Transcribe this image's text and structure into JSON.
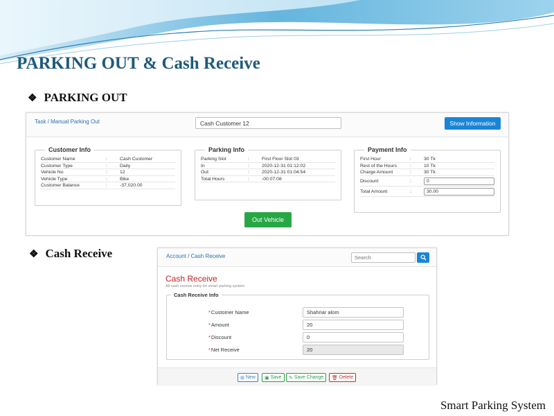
{
  "slide": {
    "title": "PARKING OUT & Cash Receive",
    "section1": "PARKING OUT",
    "section2": "Cash Receive",
    "footer": "Smart Parking System",
    "bullet": "❖"
  },
  "parking_out": {
    "breadcrumb": "Task / Manual Parking Out",
    "customer_select_value": "Cash Customer 12",
    "show_button": "Show Information",
    "out_button": "Out Vehicle",
    "customer_info": {
      "legend": "Customer Info",
      "rows": [
        {
          "k": "Customer Name",
          "v": "Cash Customer"
        },
        {
          "k": "Customer Type",
          "v": "Daily"
        },
        {
          "k": "Vehicle No",
          "v": "12"
        },
        {
          "k": "Vehicle Type",
          "v": "Bike"
        },
        {
          "k": "Customer Balance",
          "v": "-37,020.00"
        }
      ]
    },
    "parking_info": {
      "legend": "Parking Info",
      "rows": [
        {
          "k": "Parking Slot",
          "v": "First Floor Slot 03"
        },
        {
          "k": "In",
          "v": "2020-12-31 01:12:02"
        },
        {
          "k": "Out",
          "v": "2020-12-31 01:04:54"
        },
        {
          "k": "Total Hours",
          "v": "-00:07:08"
        }
      ]
    },
    "payment_info": {
      "legend": "Payment Info",
      "rows": [
        {
          "k": "First Hour",
          "v": "30 Tk"
        },
        {
          "k": "Rest of the Hours",
          "v": "10 Tk"
        },
        {
          "k": "Charge Amount",
          "v": "30 Tk"
        }
      ],
      "discount_label": "Discount",
      "discount_value": "0",
      "total_label": "Total Amount",
      "total_value": "30.00"
    },
    "colon": ":"
  },
  "cash_receive": {
    "breadcrumb": "Account / Cash Receive",
    "search_placeholder": "Search",
    "title": "Cash Receive",
    "subtitle": "All cash receive entry for smart parking system",
    "legend": "Cash Receive Info",
    "fields": [
      {
        "label": "Customer Name",
        "value": "Shahriar alom"
      },
      {
        "label": "Amount",
        "value": "20"
      },
      {
        "label": "Discount",
        "value": "0"
      },
      {
        "label": "Net Receive",
        "value": "20"
      }
    ],
    "required_mark": "*",
    "buttons": {
      "new": "New",
      "save": "Save",
      "save_change": "Save Change",
      "delete": "Delete"
    }
  },
  "colors": {
    "title": "#1e5a7a",
    "primary": "#1a85d6",
    "success": "#27a744",
    "danger": "#c81b1b"
  }
}
